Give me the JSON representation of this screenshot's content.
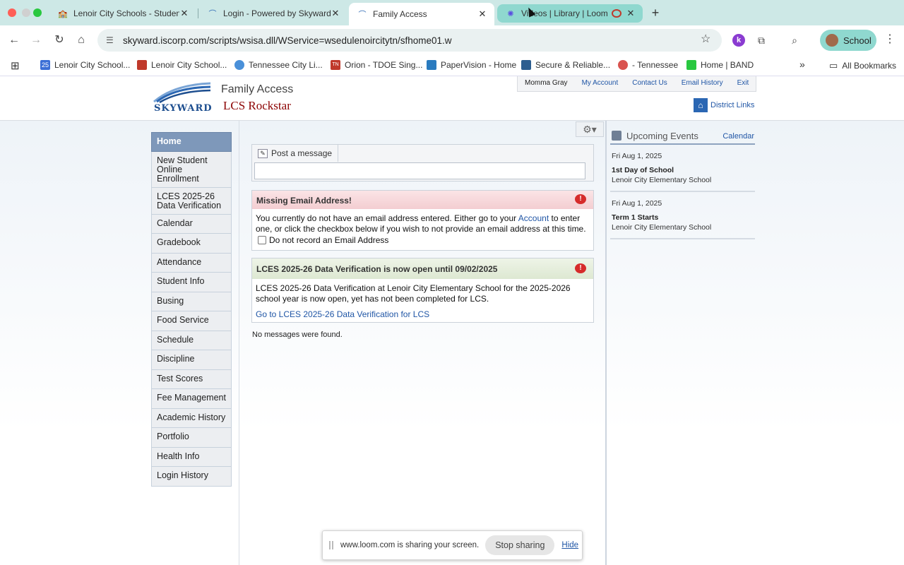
{
  "browser": {
    "tabs": [
      {
        "label": "Lenoir City Schools - Student",
        "active": false
      },
      {
        "label": "Login - Powered by Skyward",
        "active": false
      },
      {
        "label": "Family Access",
        "active": true
      },
      {
        "label": "Videos | Library | Loom",
        "active": false
      }
    ],
    "new_tab": "+",
    "url": "skyward.iscorp.com/scripts/wsisa.dll/WService=wsedulenoircitytn/sfhome01.w",
    "profile_label": "School",
    "extension_badge": "k",
    "bookmarks": [
      {
        "label": "Lenoir City School...",
        "color": "#3b6fd6",
        "icon": "calendar-icon"
      },
      {
        "label": "Lenoir City School...",
        "color": "#c0392b",
        "icon": "school-icon"
      },
      {
        "label": "Tennessee City Li...",
        "color": "#4a90d9",
        "icon": "globe-icon"
      },
      {
        "label": "Orion - TDOE Sing...",
        "color": "#c0392b",
        "icon": "tn-icon"
      },
      {
        "label": "PaperVision - Home",
        "color": "#2a7bbf",
        "icon": "papervision-icon"
      },
      {
        "label": "Secure & Reliable...",
        "color": "#2c5d8f",
        "icon": "monitor-icon"
      },
      {
        "label": "- Tennessee",
        "color": "#d9534f",
        "icon": "seal-icon"
      },
      {
        "label": "Home | BAND",
        "color": "#29c840",
        "icon": "band-icon"
      }
    ],
    "more_bookmarks": "»",
    "all_bookmarks": "All Bookmarks"
  },
  "header": {
    "logo_text": "SKYWARD",
    "product": "Family Access",
    "district_name": "LCS Rockstar",
    "top_links": [
      "Momma Gray",
      "My Account",
      "Contact Us",
      "Email History",
      "Exit"
    ],
    "district_links": "District Links"
  },
  "sidebar": {
    "items": [
      {
        "label": "Home"
      },
      {
        "label": "New Student Online Enrollment"
      },
      {
        "label": "LCES 2025-26 Data Verification"
      },
      {
        "label": "Calendar"
      },
      {
        "label": "Gradebook"
      },
      {
        "label": "Attendance"
      },
      {
        "label": "Student Info"
      },
      {
        "label": "Busing"
      },
      {
        "label": "Food Service"
      },
      {
        "label": "Schedule"
      },
      {
        "label": "Discipline"
      },
      {
        "label": "Test Scores"
      },
      {
        "label": "Fee Management"
      },
      {
        "label": "Academic History"
      },
      {
        "label": "Portfolio"
      },
      {
        "label": "Health Info"
      },
      {
        "label": "Login History"
      }
    ]
  },
  "main": {
    "post_message": "Post a message",
    "missing_email": {
      "title": "Missing Email Address!",
      "body_before": "You currently do not have an email address entered. Either go to your ",
      "account_link": "Account",
      "body_after": " to enter one, or click the checkbox below if you wish to not provide an email address at this time.",
      "checkbox_label": "Do not record an Email Address"
    },
    "verification": {
      "title": "LCES 2025-26 Data Verification is now open until 09/02/2025",
      "body": "LCES 2025-26 Data Verification at Lenoir City Elementary School for the 2025-2026 school year is now open, yet has not been completed for LCS.",
      "link": "Go to LCES 2025-26 Data Verification for LCS"
    },
    "no_messages": "No messages were found."
  },
  "events": {
    "title": "Upcoming Events",
    "calendar_link": "Calendar",
    "items": [
      {
        "date": "Fri Aug 1, 2025",
        "name": "1st Day of School",
        "school": "Lenoir City Elementary School"
      },
      {
        "date": "Fri Aug 1, 2025",
        "name": "Term 1 Starts",
        "school": "Lenoir City Elementary School"
      }
    ]
  },
  "loom_bar": {
    "text": "www.loom.com is sharing your screen.",
    "stop": "Stop sharing",
    "hide": "Hide"
  }
}
